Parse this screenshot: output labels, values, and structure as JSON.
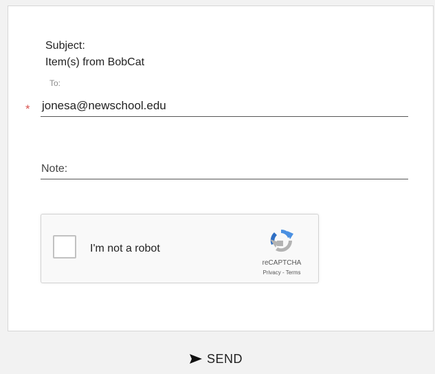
{
  "form": {
    "subject_label": "Subject:",
    "subject_value": "Item(s) from BobCat",
    "to_label": "To:",
    "required_mark": "*",
    "to_value": "jonesa@newschool.edu",
    "note_label": "Note:"
  },
  "recaptcha": {
    "checkbox_label": "I'm not a robot",
    "brand": "reCAPTCHA",
    "privacy_link": "Privacy",
    "separator": " - ",
    "terms_link": "Terms"
  },
  "actions": {
    "send_label": "SEND",
    "send_icon": "send-arrow-icon"
  },
  "colors": {
    "required": "#d9534f",
    "recaptcha_blue": "#4a90e2",
    "recaptcha_gray": "#b3b3b3"
  }
}
